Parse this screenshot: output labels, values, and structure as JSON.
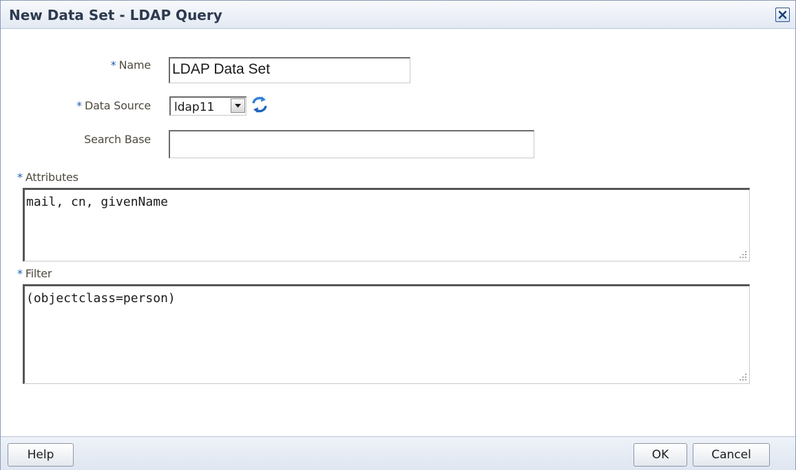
{
  "dialog": {
    "title": "New Data Set - LDAP Query"
  },
  "form": {
    "name": {
      "required_marker": "*",
      "label": "Name",
      "value": "LDAP Data Set"
    },
    "data_source": {
      "required_marker": "*",
      "label": "Data Source",
      "value": "ldap11"
    },
    "search_base": {
      "label": "Search Base",
      "value": ""
    },
    "attributes": {
      "required_marker": "*",
      "label": "Attributes",
      "value": "mail, cn, givenName"
    },
    "filter": {
      "required_marker": "*",
      "label": "Filter",
      "value": "(objectclass=person)"
    }
  },
  "footer": {
    "help_label": "Help",
    "ok_label": "OK",
    "cancel_label": "Cancel"
  },
  "icons": {
    "close": "close-icon",
    "refresh": "refresh-icon",
    "dropdown": "chevron-down-icon",
    "resize": "resize-grip-icon"
  },
  "colors": {
    "required": "#1a5fb4",
    "label": "#4e4a3e",
    "titlebar": "#e3e9f3",
    "footer": "#dfe6f1"
  }
}
